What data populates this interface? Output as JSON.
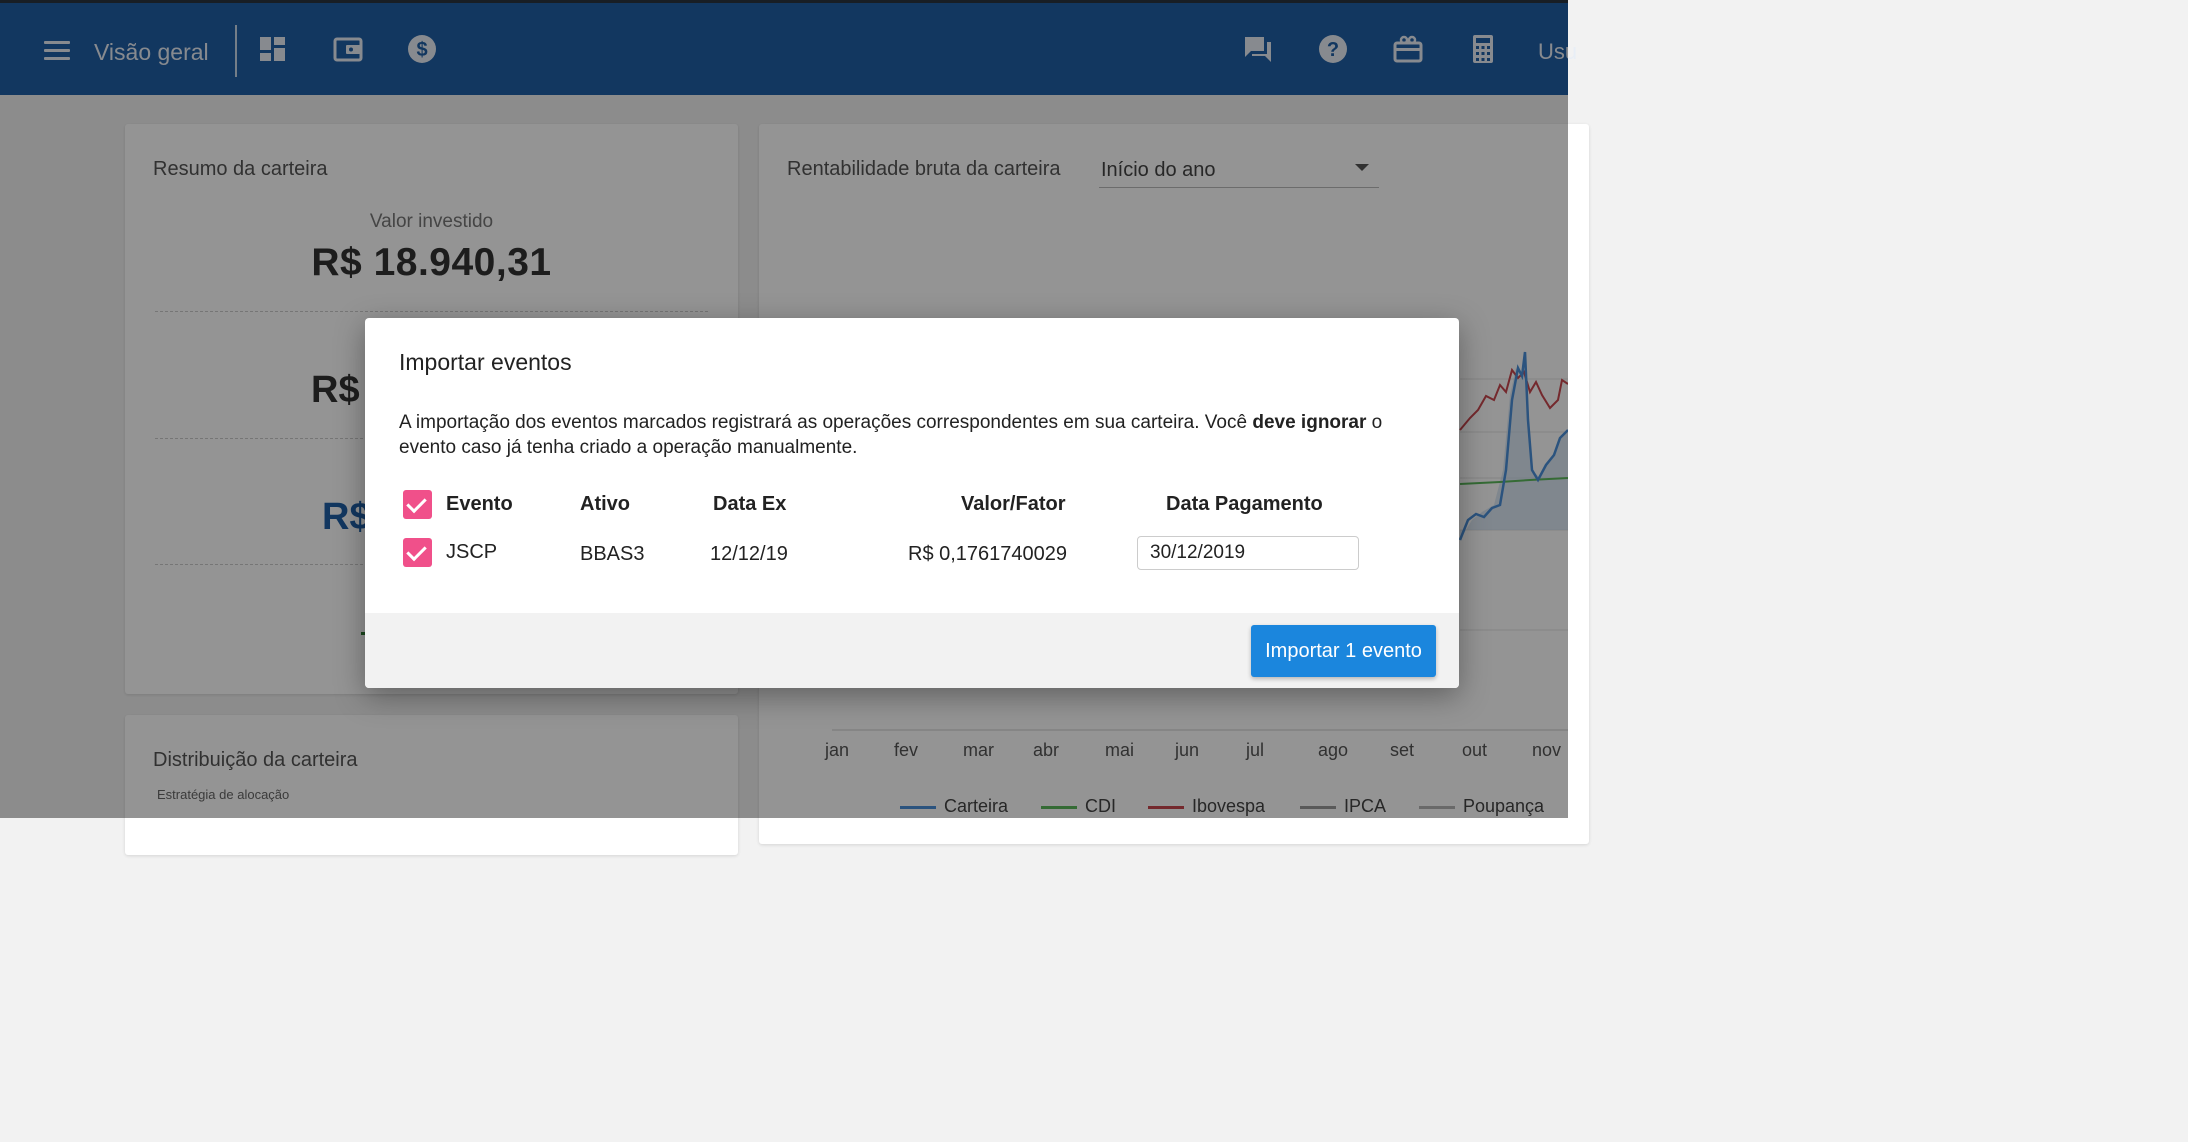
{
  "header": {
    "title": "Visão geral",
    "user_label": "Usu"
  },
  "resumo": {
    "title": "Resumo da carteira",
    "invested_label": "Valor investido",
    "invested_value": "R$ 18.940,31",
    "value2_partial": "R$",
    "value3_partial": "R$"
  },
  "rentabilidade": {
    "title": "Rentabilidade bruta da carteira",
    "period_selected": "Início do ano"
  },
  "chart_data": {
    "type": "line",
    "x_ticks": [
      "jan",
      "fev",
      "mar",
      "abr",
      "mai",
      "jun",
      "jul",
      "ago",
      "set",
      "out",
      "nov"
    ],
    "legend": [
      {
        "name": "Carteira",
        "color": "#4a90d9"
      },
      {
        "name": "CDI",
        "color": "#5cb85c"
      },
      {
        "name": "Ibovespa",
        "color": "#c9474f"
      },
      {
        "name": "IPCA",
        "color": "#9a9a9a"
      },
      {
        "name": "Poupança",
        "color": "#b5b5b5"
      }
    ],
    "legend_placement": "bottom",
    "grid": true
  },
  "distribuicao": {
    "title": "Distribuição da carteira",
    "subtitle": "Estratégia de alocação"
  },
  "modal": {
    "title": "Importar eventos",
    "desc_part1": "A importação dos eventos marcados registrará as operações correspondentes em sua carteira. Você ",
    "desc_bold": "deve ignorar",
    "desc_part2": " o evento caso já tenha criado a operação manualmente.",
    "columns": [
      "Evento",
      "Ativo",
      "Data Ex",
      "Valor/Fator",
      "Data Pagamento"
    ],
    "rows": [
      {
        "evento": "JSCP",
        "ativo": "BBAS3",
        "data_ex": "12/12/19",
        "valor": "R$ 0,1761740029",
        "data_pagamento": "30/12/2019",
        "checked": true
      }
    ],
    "import_button": "Importar 1 evento"
  },
  "colors": {
    "header_bg": "#1f5fa6",
    "checkbox": "#f0508a",
    "primary_button": "#1b86dd"
  }
}
